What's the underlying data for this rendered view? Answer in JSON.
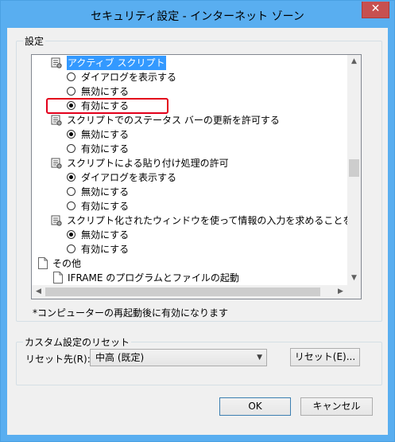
{
  "window": {
    "title": "セキュリティ設定 - インターネット ゾーン",
    "close_glyph": "✕"
  },
  "settings_group": {
    "label": "設定"
  },
  "tree": {
    "rows": [
      {
        "type": "header",
        "icon": "script-settings-icon",
        "label": "アクティブ スクリプト",
        "selected_label": true
      },
      {
        "type": "radio",
        "label": "ダイアログを表示する",
        "checked": false
      },
      {
        "type": "radio",
        "label": "無効にする",
        "checked": false
      },
      {
        "type": "radio",
        "label": "有効にする",
        "checked": true
      },
      {
        "type": "header",
        "icon": "script-settings-icon",
        "label": "スクリプトでのステータス バーの更新を許可する"
      },
      {
        "type": "radio",
        "label": "無効にする",
        "checked": true
      },
      {
        "type": "radio",
        "label": "有効にする",
        "checked": false
      },
      {
        "type": "header",
        "icon": "script-settings-icon",
        "label": "スクリプトによる貼り付け処理の許可"
      },
      {
        "type": "radio",
        "label": "ダイアログを表示する",
        "checked": true
      },
      {
        "type": "radio",
        "label": "無効にする",
        "checked": false
      },
      {
        "type": "radio",
        "label": "有効にする",
        "checked": false
      },
      {
        "type": "header",
        "icon": "script-settings-icon",
        "label": "スクリプト化されたウィンドウを使って情報の入力を求めることを Web サイトに許可する"
      },
      {
        "type": "radio",
        "label": "無効にする",
        "checked": true
      },
      {
        "type": "radio",
        "label": "有効にする",
        "checked": false
      },
      {
        "type": "category",
        "icon": "page-icon",
        "label": "その他"
      },
      {
        "type": "subcategory",
        "icon": "page-icon",
        "label": "IFRAME のプログラムとファイルの起動"
      }
    ]
  },
  "note": "*コンピューターの再起動後に有効になります",
  "reset_group": {
    "label": "カスタム設定のリセット",
    "reset_to_label": "リセット先(R):",
    "selected_level": "中高 (既定)",
    "reset_button": "リセット(E)..."
  },
  "footer": {
    "ok_label": "OK",
    "cancel_label": "キャンセル"
  },
  "colors": {
    "title_bar": "#59aef0",
    "selection": "#3399ff",
    "highlight": "#e3001b",
    "close": "#c75050"
  }
}
